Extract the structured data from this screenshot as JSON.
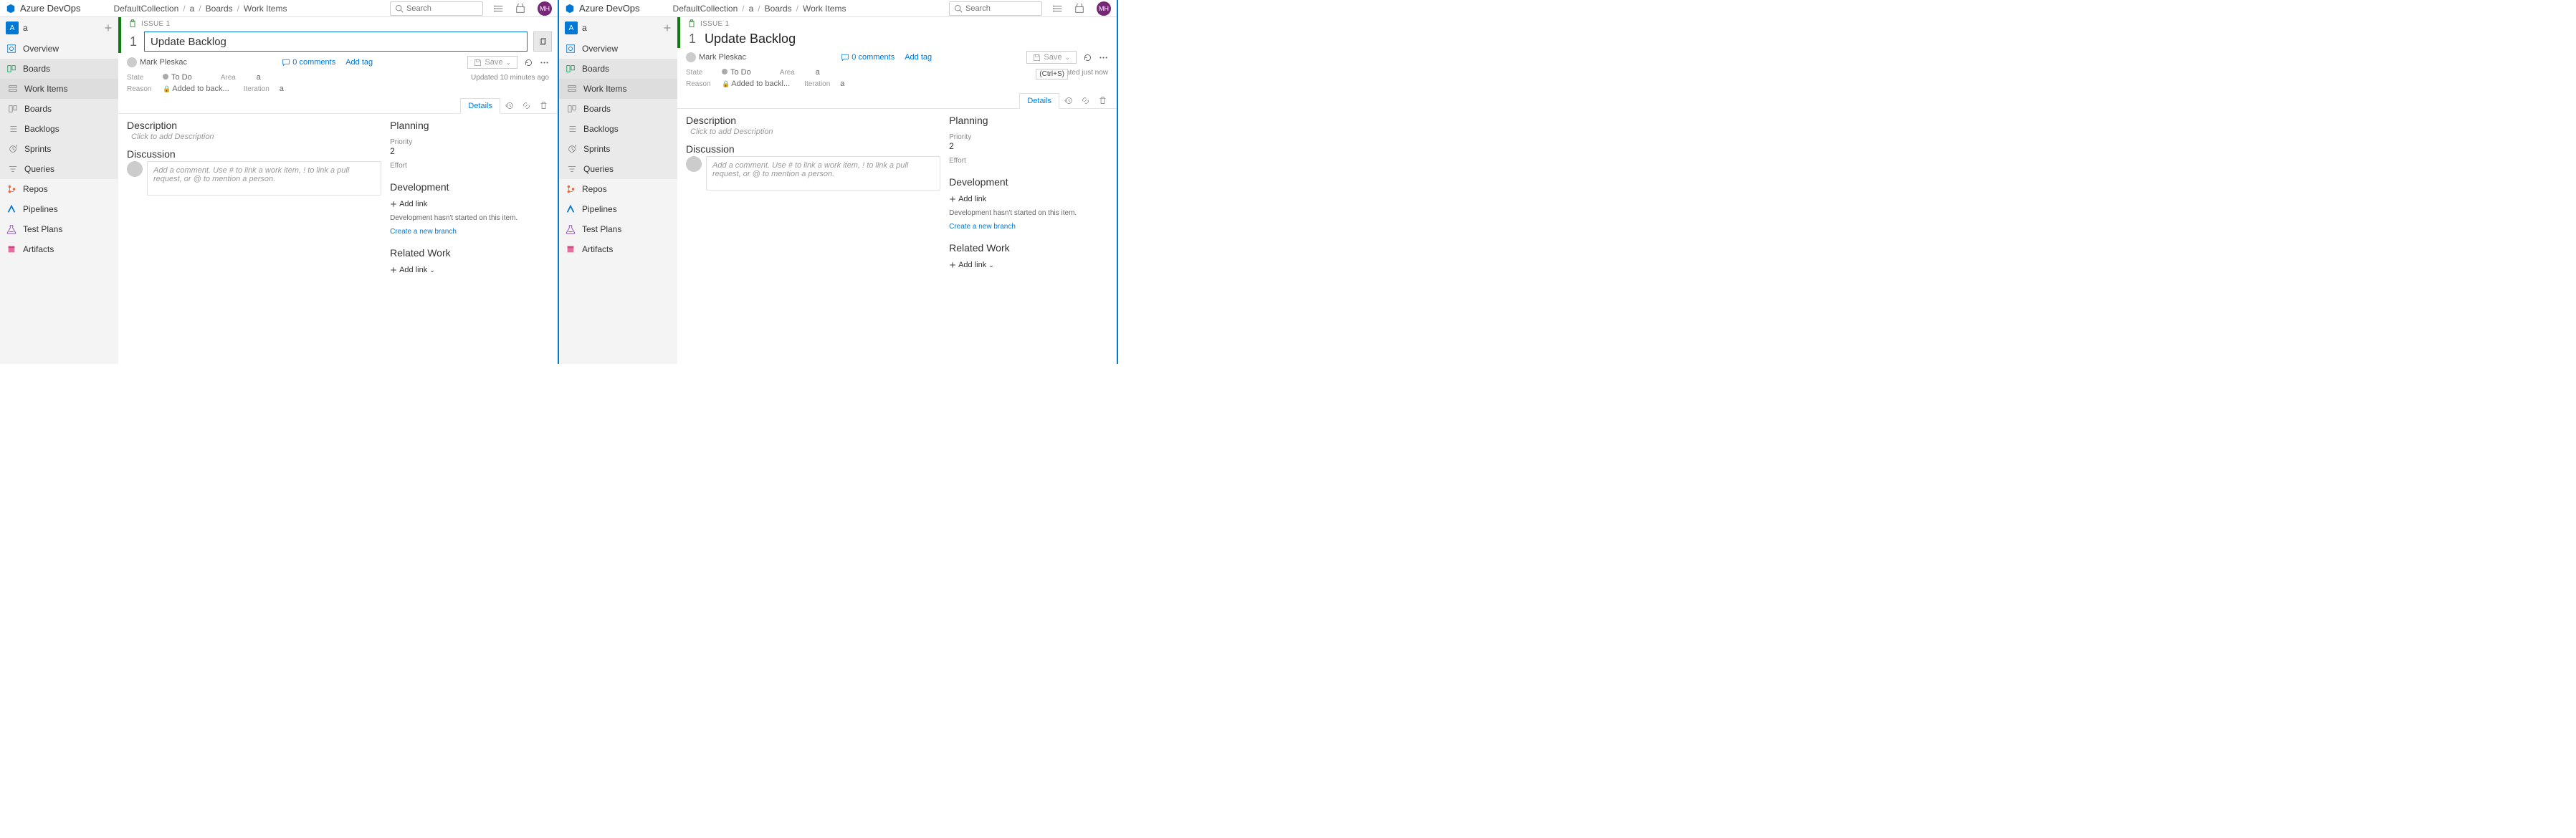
{
  "product": "Azure DevOps",
  "breadcrumbs": [
    "DefaultCollection",
    "a",
    "Boards",
    "Work Items"
  ],
  "search_placeholder": "Search",
  "avatar_initials": "MH",
  "project": {
    "badge": "A",
    "name": "a"
  },
  "nav": {
    "overview": "Overview",
    "boards": "Boards",
    "work_items": "Work Items",
    "boards_sub": "Boards",
    "backlogs": "Backlogs",
    "sprints": "Sprints",
    "queries": "Queries",
    "repos": "Repos",
    "pipelines": "Pipelines",
    "test_plans": "Test Plans",
    "artifacts": "Artifacts"
  },
  "left": {
    "issue_label": "ISSUE 1",
    "number": "1",
    "title": "Update Backlog",
    "assigned_to": "Mark Pleskac",
    "comments": "0 comments",
    "add_tag": "Add tag",
    "save": "Save",
    "state_label": "State",
    "state_value": "To Do",
    "area_label": "Area",
    "area_value": "a",
    "reason_label": "Reason",
    "reason_value": "Added to back...",
    "iteration_label": "Iteration",
    "iteration_value": "a",
    "updated": "Updated 10 minutes ago",
    "details_tab": "Details",
    "description_title": "Description",
    "description_placeholder": "Click to add Description",
    "discussion_title": "Discussion",
    "discussion_placeholder": "Add a comment. Use # to link a work item, ! to link a pull request, or @ to mention a person.",
    "planning_title": "Planning",
    "priority_label": "Priority",
    "priority_value": "2",
    "effort_label": "Effort",
    "development_title": "Development",
    "add_link": "Add link",
    "dev_not_started": "Development hasn't started on this item.",
    "create_branch": "Create a new branch",
    "related_title": "Related Work",
    "add_link_chev": "Add link"
  },
  "right": {
    "issue_label": "ISSUE 1",
    "number": "1",
    "title": "Update Backlog",
    "assigned_to": "Mark Pleskac",
    "comments": "0 comments",
    "add_tag": "Add tag",
    "save": "Save",
    "save_tooltip": "(Ctrl+S)",
    "state_label": "State",
    "state_value": "To Do",
    "area_label": "Area",
    "area_value": "a",
    "reason_label": "Reason",
    "reason_value": "Added to backl...",
    "iteration_label": "Iteration",
    "iteration_value": "a",
    "updated": "Updated just now",
    "details_tab": "Details",
    "description_title": "Description",
    "description_placeholder": "Click to add Description",
    "discussion_title": "Discussion",
    "discussion_placeholder": "Add a comment. Use # to link a work item, ! to link a pull request, or @ to mention a person.",
    "planning_title": "Planning",
    "priority_label": "Priority",
    "priority_value": "2",
    "effort_label": "Effort",
    "development_title": "Development",
    "add_link": "Add link",
    "dev_not_started": "Development hasn't started on this item.",
    "create_branch": "Create a new branch",
    "related_title": "Related Work",
    "add_link_chev": "Add link"
  }
}
